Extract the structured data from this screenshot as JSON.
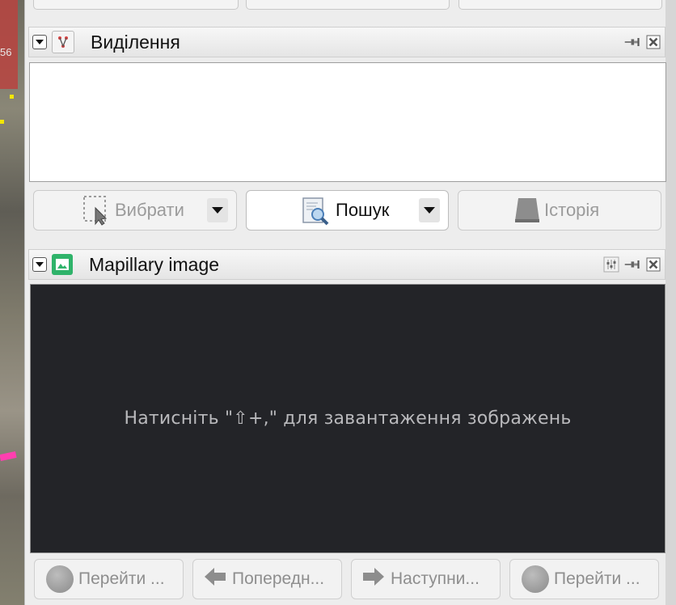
{
  "map": {
    "label_fragment": "56"
  },
  "selection_panel": {
    "title": "Виділення",
    "buttons": {
      "select": "Вибрати",
      "search": "Пошук",
      "history": "Історія"
    }
  },
  "mapillary_panel": {
    "title": "Mapillary image",
    "message": "Натисніть \"⇧+,\" для завантаження зображень",
    "nav": {
      "jump1": "Перейти ...",
      "prev": "Попередн...",
      "next": "Наступни...",
      "jump2": "Перейти ..."
    }
  },
  "icons": {
    "collapse": "chevron-down-icon",
    "selection": "selection-icon",
    "mapillary": "image-icon",
    "pin": "pin-icon",
    "close": "close-icon",
    "settings": "settings-icon",
    "select": "select-cursor-icon",
    "search": "magnifier-icon",
    "history": "history-icon"
  },
  "colors": {
    "accent_green": "#2fb36a",
    "viewer_bg": "#232428",
    "road_red": "#b9433f",
    "road_pink": "#ff3fb0"
  }
}
